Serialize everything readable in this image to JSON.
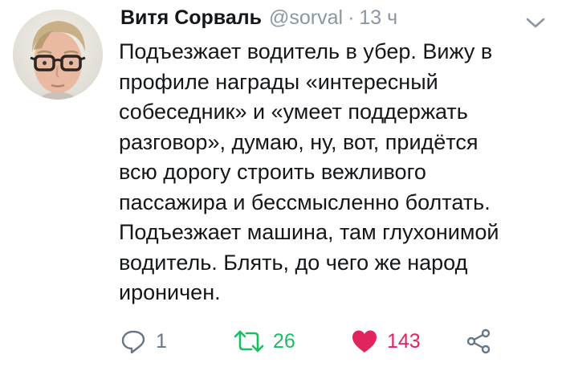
{
  "tweet": {
    "author": {
      "name": "Витя Сорваль",
      "handle": "@sorval",
      "separator": "·",
      "time": "13 ч"
    },
    "text_lines": [
      "Подъезжает водитель в убер. Вижу  в",
      "профиле награды «интересный",
      "собеседник» и «умеет поддержать",
      "разговор», думаю, ну, вот, придётся",
      "всю дорогу строить вежливого",
      "пассажира и бессмысленно болтать.",
      "Подъезжает машина, там глухонимой",
      "водитель. Блять, до чего же народ",
      "ироничен."
    ],
    "actions": {
      "reply": {
        "icon": "reply-icon",
        "count": "1",
        "color": "#657786"
      },
      "retweet": {
        "icon": "retweet-icon",
        "count": "26",
        "color": "#17bf63"
      },
      "like": {
        "icon": "heart-icon",
        "count": "143",
        "color": "#e0245e",
        "liked": true
      },
      "share": {
        "icon": "share-icon"
      }
    },
    "menu": {
      "icon": "chevron-down-icon"
    }
  },
  "colors": {
    "text": "#14171a",
    "muted": "#8a97a3",
    "retweet": "#17bf63",
    "like": "#e0245e"
  }
}
